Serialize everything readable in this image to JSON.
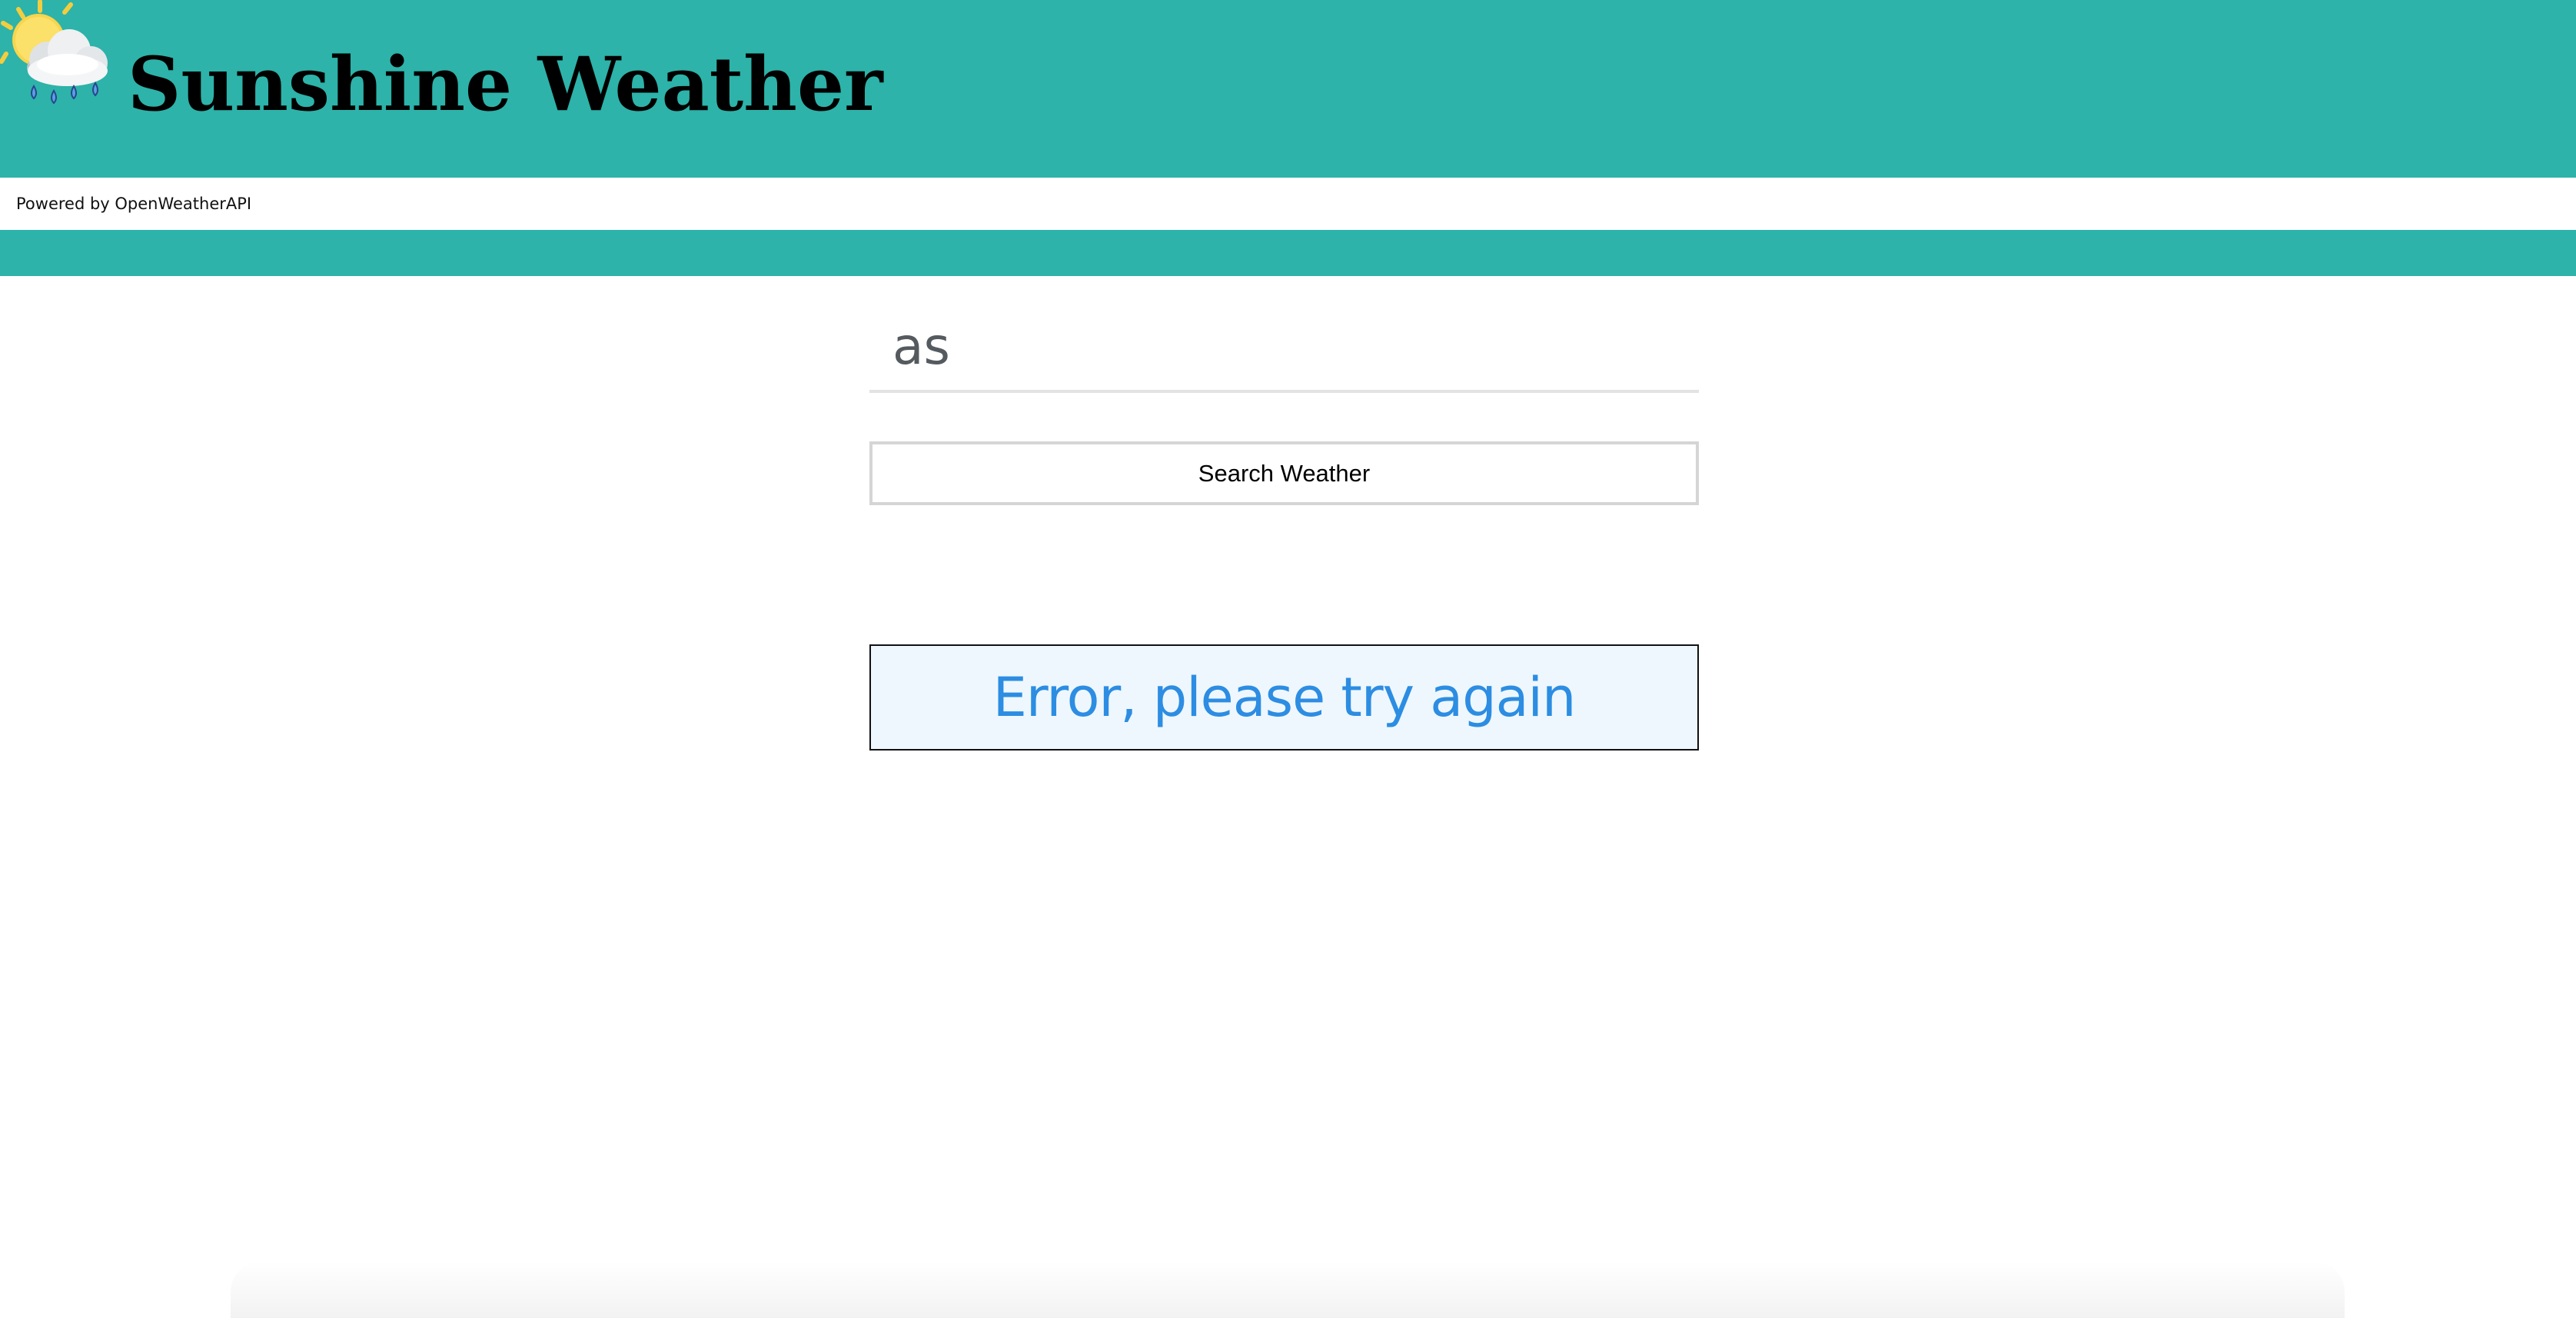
{
  "header": {
    "title": "Sunshine Weather",
    "logo_icon": "sun-cloud-rain-icon",
    "background_color": "#2db3a9"
  },
  "subbar": {
    "powered_by": "Powered by OpenWeatherAPI"
  },
  "search": {
    "value": "as",
    "button_label": "Search Weather"
  },
  "error": {
    "message": "Error, please try again",
    "text_color": "#2c8de2",
    "background_color": "#eef7fe"
  }
}
